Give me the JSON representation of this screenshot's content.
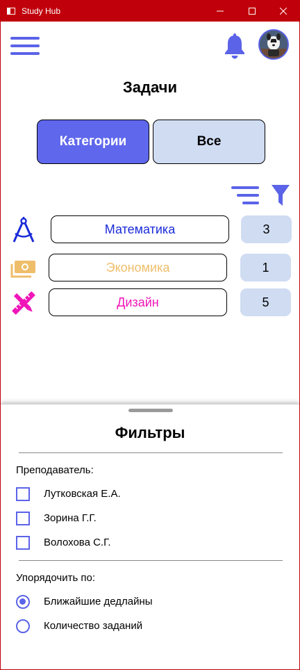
{
  "window": {
    "title": "Study Hub",
    "titlebar_color": "#c0000a",
    "icons": [
      "app-icon",
      "minimize-icon",
      "maximize-icon",
      "close-icon"
    ]
  },
  "header": {
    "menu_icon": "hamburger-menu-icon",
    "notifications_icon": "bell-icon",
    "avatar": "user-avatar"
  },
  "page": {
    "title": "Задачи",
    "tabs": [
      {
        "label": "Категории",
        "active": true
      },
      {
        "label": "Все",
        "active": false
      }
    ],
    "toolbar_icons": [
      "sort-icon",
      "filter-icon"
    ]
  },
  "categories": [
    {
      "name": "Математика",
      "count": "3",
      "color": "#1a2bd8",
      "icon": "compass-icon"
    },
    {
      "name": "Экономика",
      "count": "1",
      "color": "#efbe6a",
      "icon": "money-icon"
    },
    {
      "name": "Дизайн",
      "count": "5",
      "color": "#f016b8",
      "icon": "design-tools-icon"
    }
  ],
  "filters": {
    "title": "Фильтры",
    "teacher_label": "Преподаватель:",
    "teachers": [
      {
        "name": "Лутковская Е.А.",
        "checked": false
      },
      {
        "name": "Зорина Г.Г.",
        "checked": false
      },
      {
        "name": "Волохова С.Г.",
        "checked": false
      }
    ],
    "sort_label": "Упорядочить по:",
    "sort_options": [
      {
        "label": "Ближайшие дедлайны",
        "selected": true
      },
      {
        "label": "Количество заданий",
        "selected": false
      }
    ]
  },
  "colors": {
    "accent": "#5b63e8",
    "active_tab": "#5f67ec",
    "light_fill": "#cfdcf2"
  }
}
